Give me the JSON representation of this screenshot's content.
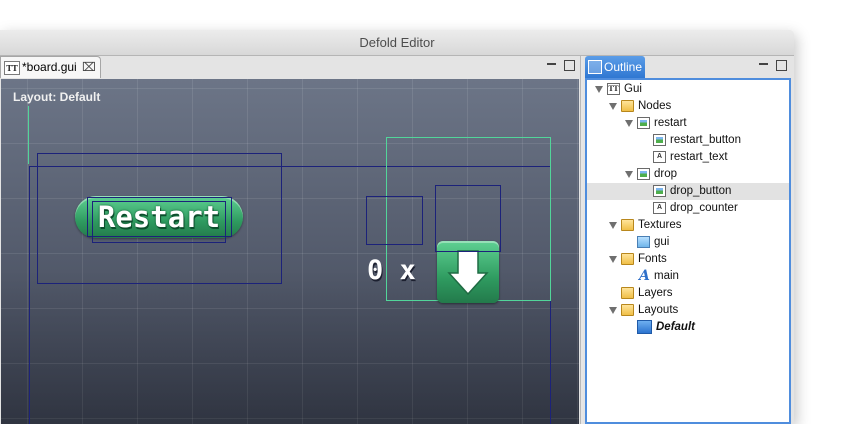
{
  "window": {
    "title": "Defold Editor"
  },
  "editor": {
    "tab": {
      "label": "*board.gui",
      "icon": "gui-file-icon",
      "close_glyph": "⌧"
    },
    "layout_label": "Layout: Default",
    "restart_text": "Restart",
    "counter_text": "0 x",
    "drop_icon": "down-arrow-icon"
  },
  "outline": {
    "tab_label": "Outline",
    "tree": [
      {
        "label": "Gui",
        "icon": "gui-icon",
        "expanded": true
      },
      {
        "label": "Nodes",
        "icon": "folder-icon",
        "expanded": true
      },
      {
        "label": "restart",
        "icon": "image-node-icon",
        "expanded": true
      },
      {
        "label": "restart_button",
        "icon": "image-node-icon"
      },
      {
        "label": "restart_text",
        "icon": "text-node-icon"
      },
      {
        "label": "drop",
        "icon": "image-node-icon",
        "expanded": true
      },
      {
        "label": "drop_button",
        "icon": "image-node-icon",
        "selected": true
      },
      {
        "label": "drop_counter",
        "icon": "text-node-icon"
      },
      {
        "label": "Textures",
        "icon": "folder-icon",
        "expanded": true
      },
      {
        "label": "gui",
        "icon": "texture-icon"
      },
      {
        "label": "Fonts",
        "icon": "folder-icon",
        "expanded": true
      },
      {
        "label": "main",
        "icon": "font-icon"
      },
      {
        "label": "Layers",
        "icon": "folder-icon"
      },
      {
        "label": "Layouts",
        "icon": "folder-icon",
        "expanded": true
      },
      {
        "label": "Default",
        "icon": "layout-icon",
        "emphasis": "bold-italic"
      }
    ]
  },
  "colors": {
    "selection_box": "#52d59a",
    "node_outline": "#1c227a",
    "button_green": "#2f9b60",
    "outline_accent": "#3a82d9"
  }
}
